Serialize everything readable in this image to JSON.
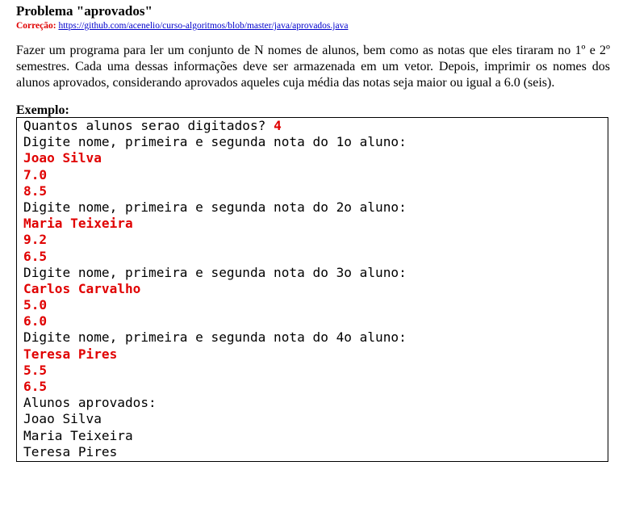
{
  "title": "Problema \"aprovados\"",
  "correcao": {
    "label": "Correção:",
    "link": "https://github.com/acenelio/curso-algoritmos/blob/master/java/aprovados.java"
  },
  "description": "Fazer um programa para ler um conjunto de N nomes de alunos, bem como as notas que eles tiraram no 1º e 2º semestres. Cada uma dessas informações deve ser armazenada em um vetor. Depois, imprimir os nomes dos alunos aprovados, considerando aprovados aqueles cuja média das notas seja maior ou igual a 6.0 (seis).",
  "example_label": "Exemplo:",
  "console": {
    "prompt_count": "Quantos alunos serao digitados? ",
    "count_value": "4",
    "lines": [
      {
        "text": "Digite nome, primeira e segunda nota do 1o aluno:",
        "input": false
      },
      {
        "text": "Joao Silva",
        "input": true
      },
      {
        "text": "7.0",
        "input": true
      },
      {
        "text": "8.5",
        "input": true
      },
      {
        "text": "Digite nome, primeira e segunda nota do 2o aluno:",
        "input": false
      },
      {
        "text": "Maria Teixeira",
        "input": true
      },
      {
        "text": "9.2",
        "input": true
      },
      {
        "text": "6.5",
        "input": true
      },
      {
        "text": "Digite nome, primeira e segunda nota do 3o aluno:",
        "input": false
      },
      {
        "text": "Carlos Carvalho",
        "input": true
      },
      {
        "text": "5.0",
        "input": true
      },
      {
        "text": "6.0",
        "input": true
      },
      {
        "text": "Digite nome, primeira e segunda nota do 4o aluno:",
        "input": false
      },
      {
        "text": "Teresa Pires",
        "input": true
      },
      {
        "text": "5.5",
        "input": true
      },
      {
        "text": "6.5",
        "input": true
      },
      {
        "text": "Alunos aprovados:",
        "input": false
      },
      {
        "text": "Joao Silva",
        "input": false
      },
      {
        "text": "Maria Teixeira",
        "input": false
      },
      {
        "text": "Teresa Pires",
        "input": false
      }
    ]
  },
  "colors": {
    "input_text": "#e00000",
    "link": "#0000cc",
    "label_red": "#e00000"
  }
}
